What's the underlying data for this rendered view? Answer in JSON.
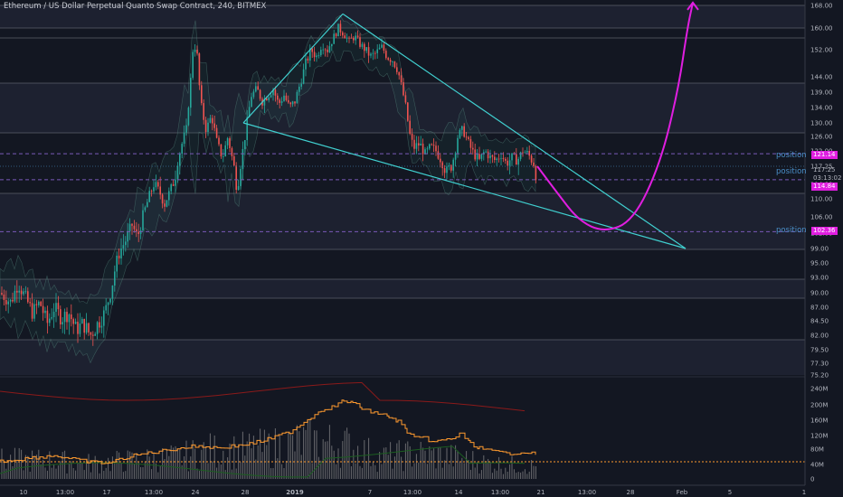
{
  "title": "Ethereum / US Dollar Perpetual Quanto Swap Contract, 240, BITMEX",
  "colors": {
    "background": "#131722",
    "up": "#26a69a",
    "down": "#ef5350",
    "wedge": "#40d0d0",
    "projection": "#e01ee0",
    "position_line": "#7a5ab8",
    "volume": "#8d8d8d",
    "obv": "#ff9a2e"
  },
  "price_axis": {
    "ticks": [
      "168.00",
      "160.00",
      "152.00",
      "144.00",
      "139.00",
      "134.00",
      "130.00",
      "126.00",
      "122.00",
      "117.25",
      "114.00",
      "110.00",
      "106.00",
      "102.00",
      "99.00",
      "95.00",
      "93.00",
      "90.00",
      "87.00",
      "84.50",
      "82.00",
      "79.50",
      "77.30",
      "75.20"
    ],
    "tags": [
      {
        "text": "121.14",
        "color": "#e01ee0",
        "name": "position-price-tag-upper"
      },
      {
        "text": "117.25",
        "color": "#131722",
        "name": "current-price-tag"
      },
      {
        "text": "03:13:02",
        "color": "#131722",
        "name": "countdown-tag"
      },
      {
        "text": "114.84",
        "color": "#e01ee0",
        "name": "position-price-tag-mid"
      },
      {
        "text": "102.36",
        "color": "#e01ee0",
        "name": "position-price-tag-lower"
      }
    ]
  },
  "indicator_axis": {
    "ticks": [
      "240M",
      "200M",
      "160M",
      "120M",
      "80M",
      "40M",
      "0"
    ]
  },
  "time_axis": {
    "ticks": [
      "10",
      "13:00",
      "17",
      "13:00",
      "24",
      "28",
      "2019",
      "7",
      "13:00",
      "14",
      "13:00",
      "21",
      "13:00",
      "28",
      "Feb",
      "5",
      "1"
    ]
  },
  "position_labels": [
    "position",
    "position",
    "position"
  ],
  "chart_data": {
    "type": "candlestick",
    "symbol": "Ethereum / US Dollar Perpetual Quanto Swap Contract",
    "interval": "240",
    "exchange": "BITMEX",
    "ylim": [
      74,
      170
    ],
    "price_lines": [
      121.14,
      114.84,
      102.36
    ],
    "current_price": 117.25,
    "price_path": [
      [
        0,
        90
      ],
      [
        12,
        88
      ],
      [
        20,
        92
      ],
      [
        28,
        89
      ],
      [
        36,
        86
      ],
      [
        44,
        88
      ],
      [
        52,
        84
      ],
      [
        60,
        87
      ],
      [
        68,
        85
      ],
      [
        76,
        86
      ],
      [
        84,
        83
      ],
      [
        92,
        84
      ],
      [
        100,
        82
      ],
      [
        108,
        84
      ],
      [
        116,
        86
      ],
      [
        122,
        90
      ],
      [
        128,
        95
      ],
      [
        134,
        99
      ],
      [
        140,
        101
      ],
      [
        146,
        104
      ],
      [
        152,
        101
      ],
      [
        158,
        106
      ],
      [
        164,
        110
      ],
      [
        170,
        114
      ],
      [
        176,
        112
      ],
      [
        182,
        109
      ],
      [
        188,
        112
      ],
      [
        194,
        116
      ],
      [
        200,
        123
      ],
      [
        206,
        128
      ],
      [
        210,
        140
      ],
      [
        214,
        155
      ],
      [
        218,
        150
      ],
      [
        222,
        135
      ],
      [
        228,
        128
      ],
      [
        234,
        132
      ],
      [
        240,
        124
      ],
      [
        246,
        120
      ],
      [
        252,
        126
      ],
      [
        258,
        118
      ],
      [
        262,
        113
      ],
      [
        266,
        118
      ],
      [
        272,
        128
      ],
      [
        278,
        138
      ],
      [
        284,
        140
      ],
      [
        290,
        136
      ],
      [
        296,
        138
      ],
      [
        302,
        140
      ],
      [
        308,
        135
      ],
      [
        314,
        138
      ],
      [
        320,
        134
      ],
      [
        326,
        136
      ],
      [
        332,
        142
      ],
      [
        338,
        148
      ],
      [
        344,
        152
      ],
      [
        350,
        150
      ],
      [
        356,
        154
      ],
      [
        362,
        152
      ],
      [
        368,
        156
      ],
      [
        374,
        160
      ],
      [
        380,
        158
      ],
      [
        386,
        155
      ],
      [
        392,
        157
      ],
      [
        398,
        154
      ],
      [
        404,
        152
      ],
      [
        410,
        150
      ],
      [
        416,
        151
      ],
      [
        422,
        153
      ],
      [
        428,
        150
      ],
      [
        434,
        149
      ],
      [
        440,
        146
      ],
      [
        446,
        138
      ],
      [
        450,
        132
      ],
      [
        454,
        125
      ],
      [
        458,
        123
      ],
      [
        464,
        124
      ],
      [
        470,
        121
      ],
      [
        476,
        123
      ],
      [
        482,
        122
      ],
      [
        488,
        119
      ],
      [
        494,
        116
      ],
      [
        500,
        118
      ],
      [
        506,
        126
      ],
      [
        512,
        128
      ],
      [
        518,
        124
      ],
      [
        524,
        121
      ],
      [
        530,
        119
      ],
      [
        536,
        122
      ],
      [
        542,
        120
      ],
      [
        548,
        119
      ],
      [
        554,
        121
      ],
      [
        560,
        118
      ],
      [
        566,
        120
      ],
      [
        572,
        119
      ],
      [
        578,
        122
      ],
      [
        584,
        121
      ],
      [
        590,
        118
      ],
      [
        594,
        115
      ]
    ],
    "volume_profile": [
      [
        0,
        0.3
      ],
      [
        50,
        0.3
      ],
      [
        100,
        0.25
      ],
      [
        150,
        0.3
      ],
      [
        200,
        0.35
      ],
      [
        230,
        0.45
      ],
      [
        260,
        0.45
      ],
      [
        300,
        0.5
      ],
      [
        340,
        0.6
      ],
      [
        380,
        0.55
      ],
      [
        420,
        0.35
      ],
      [
        460,
        0.4
      ],
      [
        500,
        0.35
      ],
      [
        540,
        0.25
      ],
      [
        594,
        0.2
      ]
    ],
    "obv_path": [
      [
        0,
        86
      ],
      [
        20,
        84
      ],
      [
        40,
        82
      ],
      [
        60,
        80
      ],
      [
        80,
        84
      ],
      [
        100,
        87
      ],
      [
        120,
        88
      ],
      [
        140,
        82
      ],
      [
        160,
        78
      ],
      [
        180,
        75
      ],
      [
        200,
        72
      ],
      [
        220,
        70
      ],
      [
        240,
        72
      ],
      [
        260,
        70
      ],
      [
        280,
        67
      ],
      [
        300,
        62
      ],
      [
        320,
        55
      ],
      [
        340,
        42
      ],
      [
        355,
        32
      ],
      [
        370,
        28
      ],
      [
        380,
        22
      ],
      [
        390,
        25
      ],
      [
        400,
        30
      ],
      [
        410,
        34
      ],
      [
        420,
        36
      ],
      [
        430,
        40
      ],
      [
        440,
        44
      ],
      [
        450,
        55
      ],
      [
        460,
        62
      ],
      [
        470,
        62
      ],
      [
        480,
        66
      ],
      [
        490,
        64
      ],
      [
        500,
        62
      ],
      [
        510,
        57
      ],
      [
        520,
        68
      ],
      [
        530,
        72
      ],
      [
        540,
        75
      ],
      [
        560,
        78
      ],
      [
        580,
        76
      ],
      [
        594,
        80
      ]
    ],
    "wedge_lines": [
      {
        "from": [
          269,
          130
        ],
        "to": [
          379,
          165
        ]
      },
      {
        "from": [
          379,
          165
        ],
        "to": [
          758,
          99
        ]
      },
      {
        "from": [
          269,
          130
        ],
        "to": [
          758,
          99
        ]
      }
    ],
    "projection_curve": [
      [
        594,
        117.25
      ],
      [
        615,
        112
      ],
      [
        640,
        105
      ],
      [
        668,
        102.2
      ],
      [
        700,
        105
      ],
      [
        730,
        118
      ],
      [
        750,
        140
      ],
      [
        760,
        160
      ],
      [
        766,
        169
      ]
    ]
  }
}
